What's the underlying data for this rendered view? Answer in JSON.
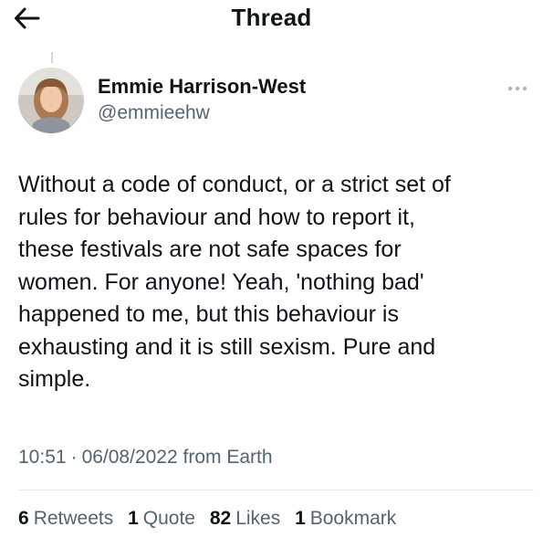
{
  "header": {
    "title": "Thread",
    "back_icon": "arrow-left-icon"
  },
  "tweet": {
    "author_name": "Emmie Harrison-West",
    "author_handle": "@emmieehw",
    "avatar": "user-avatar-photo",
    "more_icon": "more-dots-icon",
    "text": "Without a code of conduct, or a strict set of\nrules for behaviour and how to report it,\nthese festivals are not safe spaces for\nwomen. For anyone! Yeah, 'nothing bad'\nhappened to me, but this behaviour is\nexhausting and it is still sexism. Pure and\nsimple.",
    "time": "10:51",
    "separator": "·",
    "date": "06/08/2022",
    "source": "from Earth"
  },
  "stats": [
    {
      "count": "6",
      "label": "Retweets"
    },
    {
      "count": "1",
      "label": "Quote"
    },
    {
      "count": "82",
      "label": "Likes"
    },
    {
      "count": "1",
      "label": "Bookmark"
    }
  ],
  "colors": {
    "text_primary": "#0f1419",
    "text_secondary": "#536471",
    "divider": "#e6ecf0"
  }
}
